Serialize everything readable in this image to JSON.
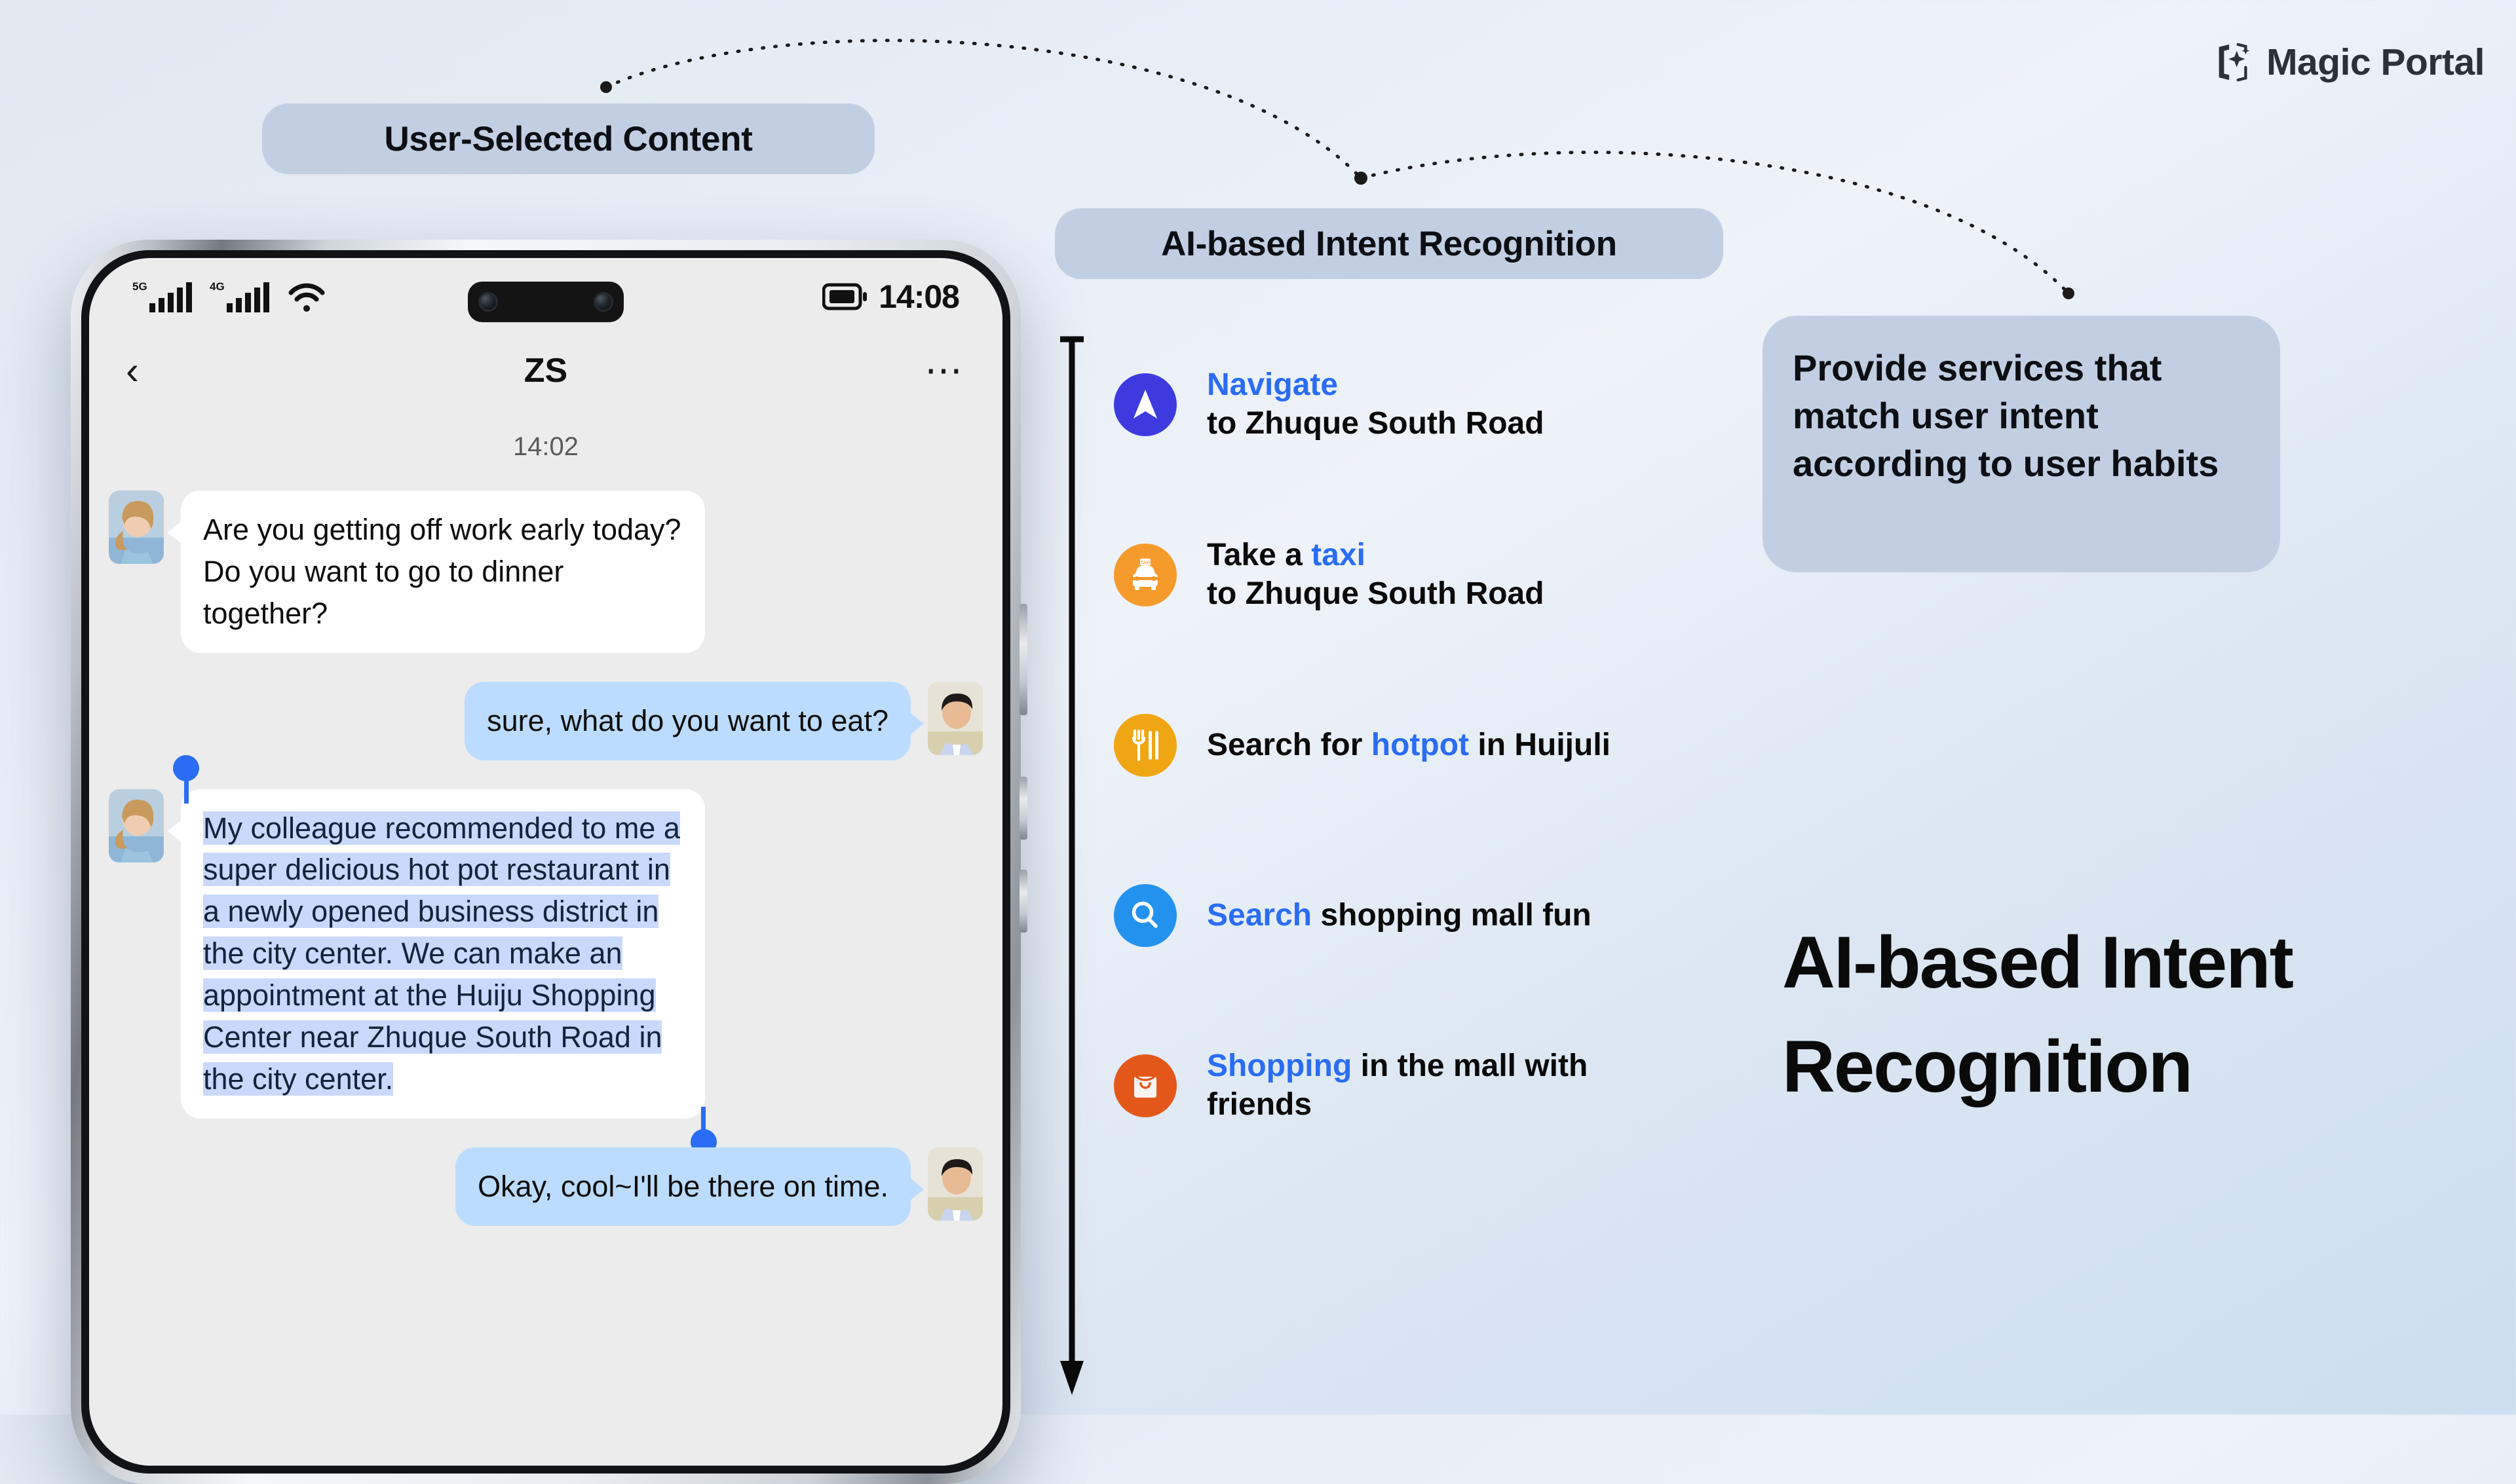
{
  "brand": {
    "name": "Magic Portal",
    "icon": "magic-portal-sparkle-icon"
  },
  "callouts": {
    "user_selected": "User-Selected Content",
    "intent_recognition": "AI-based Intent Recognition",
    "provide_services": "Provide services that match user intent according to user habits"
  },
  "headline": "AI-based Intent Recognition",
  "phone": {
    "status_bar": {
      "network_primary": "5G",
      "network_secondary": "4G",
      "wifi_icon": "wifi-icon",
      "battery_icon": "battery-icon",
      "time": "14:08"
    },
    "nav": {
      "back_icon": "chevron-left-icon",
      "title": "ZS",
      "more_icon": "more-horizontal-icon"
    },
    "chat": {
      "timestamp": "14:02",
      "messages": [
        {
          "side": "in",
          "text": "Are you getting off work early today? Do you want to go to dinner together?",
          "avatar": "avatar-woman"
        },
        {
          "side": "out",
          "text": "sure, what do you want to eat?",
          "avatar": "avatar-man"
        },
        {
          "side": "in",
          "text": "My colleague recommended to me a super delicious hot pot restaurant in a newly opened business district in the city center. We can make an appointment at the Huiju Shopping Center near Zhuque South Road in the city center.",
          "avatar": "avatar-woman",
          "selected": true
        },
        {
          "side": "out",
          "text": "Okay, cool~I'll be there on time.",
          "avatar": "avatar-man"
        }
      ]
    }
  },
  "intents": [
    {
      "icon": "navigation-arrow-icon",
      "color": "#3d3be0",
      "line1_highlight": "Navigate",
      "line1_rest": "",
      "line2": "to Zhuque South Road"
    },
    {
      "icon": "taxi-icon",
      "color": "#f59b2c",
      "line1_prefix": "Take a ",
      "line1_highlight": "taxi",
      "line2": "to Zhuque South Road"
    },
    {
      "icon": "cutlery-icon",
      "color": "#f0a512",
      "line1_prefix": "Search for ",
      "line1_highlight": "hotpot",
      "line1_suffix": " in Huijuli",
      "line2": ""
    },
    {
      "icon": "search-icon",
      "color": "#2392ef",
      "line1_highlight": "Search",
      "line1_suffix": " shopping mall fun",
      "line2": ""
    },
    {
      "icon": "shopping-bag-icon",
      "color": "#e4571b",
      "line1_highlight": "Shopping",
      "line1_suffix": " in the mall with",
      "line2": "friends"
    }
  ],
  "colors": {
    "accent_blue": "#2a6df4",
    "pill_bg": "#c2cfe3",
    "selection_bg": "#c8d9fb",
    "bubble_out": "#bcdcff",
    "screen_bg": "#ececec"
  }
}
